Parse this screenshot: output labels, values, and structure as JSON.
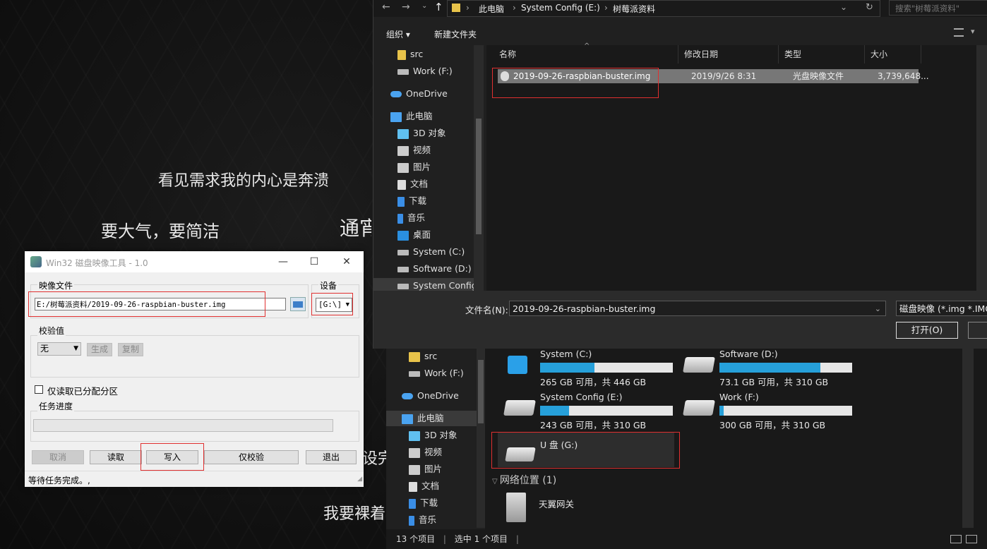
{
  "background": {
    "slogans": [
      "看见需求我的内心是奔溃",
      "要大气，要简洁",
      "通宵",
      "设完",
      "我要裸着"
    ]
  },
  "explorer_back": {
    "nav_items": [
      {
        "label": "src",
        "icon": "folder-icon"
      },
      {
        "label": "Work (F:)",
        "icon": "drive-icon"
      },
      {
        "label": "OneDrive",
        "icon": "cloud-icon"
      },
      {
        "label": "此电脑",
        "icon": "computer-icon"
      },
      {
        "label": "3D 对象",
        "icon": "cube-icon"
      },
      {
        "label": "视频",
        "icon": "video-icon"
      },
      {
        "label": "图片",
        "icon": "picture-icon"
      },
      {
        "label": "文档",
        "icon": "document-icon"
      },
      {
        "label": "下载",
        "icon": "download-icon"
      },
      {
        "label": "音乐",
        "icon": "music-icon"
      }
    ],
    "drives": [
      {
        "name": "System (C:)",
        "free": "265 GB 可用，共 446 GB",
        "used_fraction": 0.41
      },
      {
        "name": "Software (D:)",
        "free": "73.1 GB 可用，共 310 GB",
        "used_fraction": 0.76
      },
      {
        "name": "System Config (E:)",
        "free": "243 GB 可用，共 310 GB",
        "used_fraction": 0.22
      },
      {
        "name": "Work (F:)",
        "free": "300 GB 可用，共 310 GB",
        "used_fraction": 0.03
      }
    ],
    "usb_drive": "U 盘 (G:)",
    "network_header": "网络位置 (1)",
    "network_item": "天翼网关",
    "status": {
      "count": "13 个项目",
      "selected": "选中 1 个项目"
    }
  },
  "dialog": {
    "breadcrumb": [
      "此电脑",
      "System Config (E:)",
      "树莓派资料"
    ],
    "search_placeholder": "搜索\"树莓派资料\"",
    "toolbar": {
      "organize": "组织 ▾",
      "new_folder": "新建文件夹"
    },
    "nav_items": [
      {
        "label": "src"
      },
      {
        "label": "Work (F:)"
      },
      {
        "label": "OneDrive"
      },
      {
        "label": "此电脑"
      },
      {
        "label": "3D 对象"
      },
      {
        "label": "视频"
      },
      {
        "label": "图片"
      },
      {
        "label": "文档"
      },
      {
        "label": "下载"
      },
      {
        "label": "音乐"
      },
      {
        "label": "桌面"
      },
      {
        "label": "System (C:)"
      },
      {
        "label": "Software (D:)"
      },
      {
        "label": "System Config"
      }
    ],
    "columns": [
      "名称",
      "修改日期",
      "类型",
      "大小"
    ],
    "file": {
      "name": "2019-09-26-raspbian-buster.img",
      "date": "2019/9/26 8:31",
      "type": "光盘映像文件",
      "size": "3,739,648..."
    },
    "filename_label": "文件名(N):",
    "filename_value": "2019-09-26-raspbian-buster.img",
    "filetype": "磁盘映像 (*.img *.IMG)",
    "open_label": "打开(O)"
  },
  "w32": {
    "title": "Win32 磁盘映像工具 - 1.0",
    "image_group": "映像文件",
    "image_path": "E:/树莓派资料/2019-09-26-raspbian-buster.img",
    "device_group": "设备",
    "device_value": "[G:\\]",
    "hash_group": "校验值",
    "hash_select": "无",
    "generate": "生成",
    "copy": "复制",
    "read_only_alloc": "仅读取已分配分区",
    "progress_group": "任务进度",
    "progress": 0,
    "buttons": {
      "cancel": "取消",
      "read": "读取",
      "write": "写入",
      "verify": "仅校验",
      "exit": "退出"
    },
    "status": "等待任务完成。,"
  }
}
